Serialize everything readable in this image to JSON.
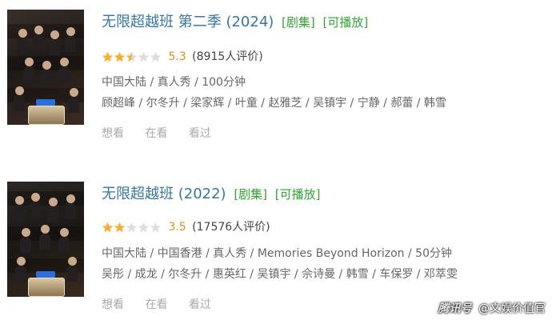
{
  "entries": [
    {
      "title": "无限超越班 第二季 (2024)",
      "tag_type": "[剧集]",
      "tag_play": "[可播放]",
      "stars": 2.5,
      "score": "5.3",
      "rating_count": "(8915人评价)",
      "meta": "中国大陆 / 真人秀 / 100分钟",
      "cast": "顾超峰 / 尔冬升 / 梁家辉 / 叶童 / 赵雅芝 / 吴镇宇 / 宁静 / 郝蕾 / 韩雪",
      "actions": [
        "想看",
        "在看",
        "看过"
      ]
    },
    {
      "title": "无限超越班 (2022)",
      "tag_type": "[剧集]",
      "tag_play": "[可播放]",
      "stars": 2.0,
      "score": "3.5",
      "rating_count": "(17576人评价)",
      "meta": "中国大陆 / 中国香港 / 真人秀 / Memories Beyond Horizon / 50分钟",
      "cast": "吴彤 / 成龙 / 尔冬升 / 惠英红 / 吴镇宇 / 佘诗曼 / 韩雪 / 车保罗 / 邓萃雯",
      "actions": [
        "想看",
        "在看",
        "看过"
      ]
    }
  ],
  "watermark": {
    "brand": "腾讯号",
    "text": "@文娱价值官"
  },
  "colors": {
    "title": "#3377aa",
    "tag": "#2fa82f",
    "star_filled": "#ffac2d",
    "star_empty": "#dddddd",
    "score": "#e09015",
    "meta": "#666666",
    "action": "#aaaaaa"
  },
  "icons": {
    "star": "star-icon",
    "half_star": "half-star-icon"
  }
}
